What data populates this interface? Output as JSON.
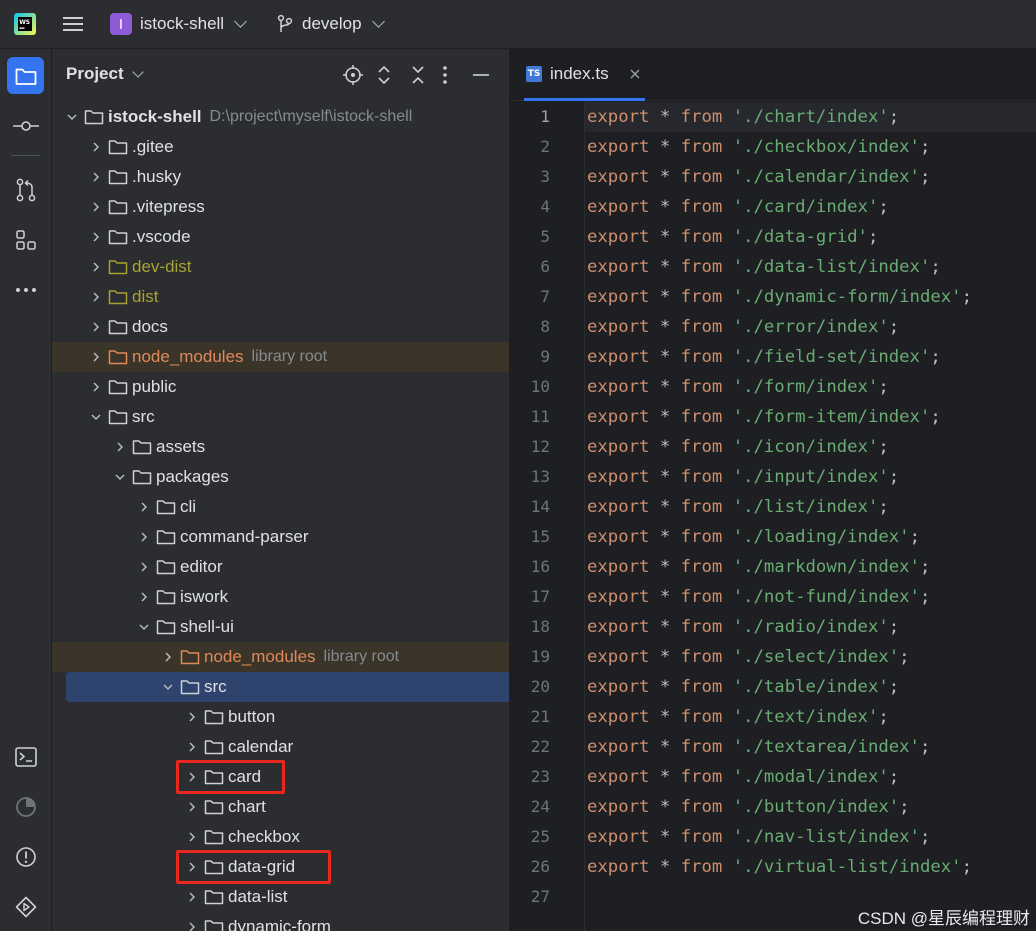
{
  "titlebar": {
    "project_name": "istock-shell",
    "project_badge": "I",
    "branch": "develop"
  },
  "panel": {
    "title": "Project"
  },
  "tree": [
    {
      "label": "istock-shell",
      "hint": "D:\\project\\myself\\istock-shell",
      "expanded": true,
      "depth": 0,
      "root": true
    },
    {
      "label": ".gitee",
      "depth": 1
    },
    {
      "label": ".husky",
      "depth": 1
    },
    {
      "label": ".vitepress",
      "depth": 1
    },
    {
      "label": ".vscode",
      "depth": 1
    },
    {
      "label": "dev-dist",
      "depth": 1,
      "color": "#a8a233"
    },
    {
      "label": "dist",
      "depth": 1,
      "color": "#a8a233"
    },
    {
      "label": "docs",
      "depth": 1
    },
    {
      "label": "node_modules",
      "hint": "library root",
      "depth": 1,
      "lib": true
    },
    {
      "label": "public",
      "depth": 1
    },
    {
      "label": "src",
      "depth": 1,
      "expanded": true
    },
    {
      "label": "assets",
      "depth": 2
    },
    {
      "label": "packages",
      "depth": 2,
      "expanded": true
    },
    {
      "label": "cli",
      "depth": 3
    },
    {
      "label": "command-parser",
      "depth": 3
    },
    {
      "label": "editor",
      "depth": 3
    },
    {
      "label": "iswork",
      "depth": 3
    },
    {
      "label": "shell-ui",
      "depth": 3,
      "expanded": true
    },
    {
      "label": "node_modules",
      "hint": "library root",
      "depth": 4,
      "lib": true
    },
    {
      "label": "src",
      "depth": 4,
      "expanded": true,
      "selected": true
    },
    {
      "label": "button",
      "depth": 5
    },
    {
      "label": "calendar",
      "depth": 5
    },
    {
      "label": "card",
      "depth": 5,
      "highlight": true
    },
    {
      "label": "chart",
      "depth": 5
    },
    {
      "label": "checkbox",
      "depth": 5
    },
    {
      "label": "data-grid",
      "depth": 5,
      "highlight": true
    },
    {
      "label": "data-list",
      "depth": 5
    },
    {
      "label": "dynamic-form",
      "depth": 5
    }
  ],
  "editor": {
    "tab_label": "index.ts",
    "tab_icon": "TS",
    "current_line": 1,
    "lines": [
      {
        "kw": "export",
        "op": " * ",
        "kw2": "from",
        "str": "'./chart/index'",
        "end": ";"
      },
      {
        "kw": "export",
        "op": " * ",
        "kw2": "from",
        "str": "'./checkbox/index'",
        "end": ";"
      },
      {
        "kw": "export",
        "op": " * ",
        "kw2": "from",
        "str": "'./calendar/index'",
        "end": ";"
      },
      {
        "kw": "export",
        "op": " * ",
        "kw2": "from",
        "str": "'./card/index'",
        "end": ";"
      },
      {
        "kw": "export",
        "op": " * ",
        "kw2": "from",
        "str": "'./data-grid'",
        "end": ";"
      },
      {
        "kw": "export",
        "op": " * ",
        "kw2": "from",
        "str": "'./data-list/index'",
        "end": ";"
      },
      {
        "kw": "export",
        "op": " * ",
        "kw2": "from",
        "str": "'./dynamic-form/index'",
        "end": ";"
      },
      {
        "kw": "export",
        "op": " * ",
        "kw2": "from",
        "str": "'./error/index'",
        "end": ";"
      },
      {
        "kw": "export",
        "op": " * ",
        "kw2": "from",
        "str": "'./field-set/index'",
        "end": ";"
      },
      {
        "kw": "export",
        "op": " * ",
        "kw2": "from",
        "str": "'./form/index'",
        "end": ";"
      },
      {
        "kw": "export",
        "op": " * ",
        "kw2": "from",
        "str": "'./form-item/index'",
        "end": ";"
      },
      {
        "kw": "export",
        "op": " * ",
        "kw2": "from",
        "str": "'./icon/index'",
        "end": ";"
      },
      {
        "kw": "export",
        "op": " * ",
        "kw2": "from",
        "str": "'./input/index'",
        "end": ";"
      },
      {
        "kw": "export",
        "op": " * ",
        "kw2": "from",
        "str": "'./list/index'",
        "end": ";"
      },
      {
        "kw": "export",
        "op": " * ",
        "kw2": "from",
        "str": "'./loading/index'",
        "end": ";"
      },
      {
        "kw": "export",
        "op": " * ",
        "kw2": "from",
        "str": "'./markdown/index'",
        "end": ";"
      },
      {
        "kw": "export",
        "op": " * ",
        "kw2": "from",
        "str": "'./not-fund/index'",
        "end": ";"
      },
      {
        "kw": "export",
        "op": " * ",
        "kw2": "from",
        "str": "'./radio/index'",
        "end": ";"
      },
      {
        "kw": "export",
        "op": " * ",
        "kw2": "from",
        "str": "'./select/index'",
        "end": ";"
      },
      {
        "kw": "export",
        "op": " * ",
        "kw2": "from",
        "str": "'./table/index'",
        "end": ";"
      },
      {
        "kw": "export",
        "op": " * ",
        "kw2": "from",
        "str": "'./text/index'",
        "end": ";"
      },
      {
        "kw": "export",
        "op": " * ",
        "kw2": "from",
        "str": "'./textarea/index'",
        "end": ";"
      },
      {
        "kw": "export",
        "op": " * ",
        "kw2": "from",
        "str": "'./modal/index'",
        "end": ";"
      },
      {
        "kw": "export",
        "op": " * ",
        "kw2": "from",
        "str": "'./button/index'",
        "end": ";"
      },
      {
        "kw": "export",
        "op": " * ",
        "kw2": "from",
        "str": "'./nav-list/index'",
        "end": ";"
      },
      {
        "kw": "export",
        "op": " * ",
        "kw2": "from",
        "str": "'./virtual-list/index'",
        "end": ";"
      },
      {
        "kw": "",
        "op": "",
        "kw2": "",
        "str": "",
        "end": ""
      }
    ]
  },
  "watermark": "CSDN @星辰编程理财",
  "colors": {
    "accent": "#3574f0",
    "keyword": "#cf8e6d",
    "string": "#6aab73",
    "excluded_folder": "#a8a233",
    "library_folder": "#e0895a",
    "highlight_box": "#e8271e"
  }
}
